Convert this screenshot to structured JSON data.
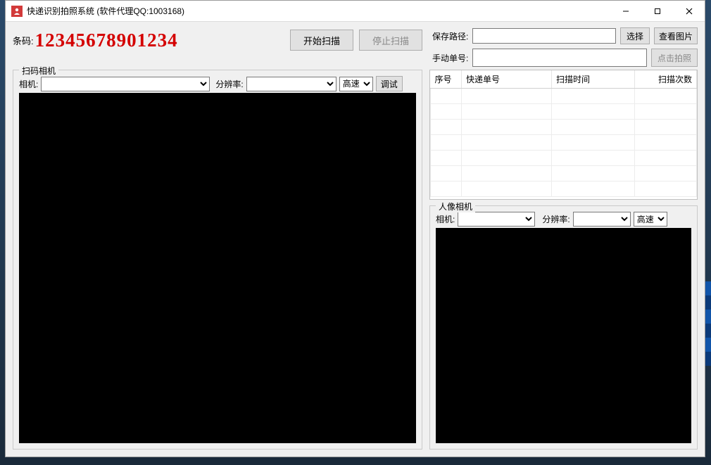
{
  "window": {
    "title": "快递识别拍照系统  (软件代理QQ:1003168)"
  },
  "top": {
    "barcode_label": "条码:",
    "barcode_value": "12345678901234",
    "start_scan": "开始扫描",
    "stop_scan": "停止扫描"
  },
  "right_top": {
    "save_path_label": "保存路径:",
    "save_path_value": "",
    "select_btn": "选择",
    "view_image_btn": "查看图片",
    "manual_no_label": "手动单号:",
    "manual_no_value": "",
    "click_photo_btn": "点击拍照"
  },
  "scan_camera": {
    "group_title": "扫码相机",
    "camera_label": "相机:",
    "camera_value": "",
    "resolution_label": "分辨率:",
    "resolution_value": "",
    "speed_value": "高速",
    "debug_btn": "调试"
  },
  "table": {
    "headers": {
      "seq": "序号",
      "express_no": "快递单号",
      "scan_time": "扫描时间",
      "scan_count": "扫描次数"
    },
    "rows": []
  },
  "portrait_camera": {
    "group_title": "人像相机",
    "camera_label": "相机:",
    "camera_value": "",
    "resolution_label": "分辨率:",
    "resolution_value": "",
    "speed_value": "高速"
  }
}
